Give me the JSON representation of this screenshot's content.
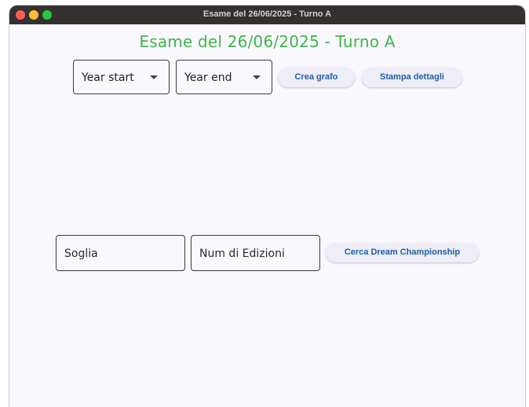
{
  "window": {
    "title": "Esame del 26/06/2025 - Turno A"
  },
  "main": {
    "heading": "Esame del 26/06/2025 - Turno A",
    "heading_color": "#3fb54a"
  },
  "row1": {
    "year_start_label": "Year start",
    "year_end_label": "Year end",
    "crea_grafo_label": "Crea grafo",
    "stampa_dettagli_label": "Stampa dettagli"
  },
  "row2": {
    "soglia_label": "Soglia",
    "num_edizioni_label": "Num di Edizioni",
    "cerca_label": "Cerca Dream Championship"
  },
  "colors": {
    "button_text": "#1f5ea8",
    "button_bg": "#efedf6",
    "window_bg": "#f9f8fe",
    "titlebar_bg": "#353030"
  }
}
